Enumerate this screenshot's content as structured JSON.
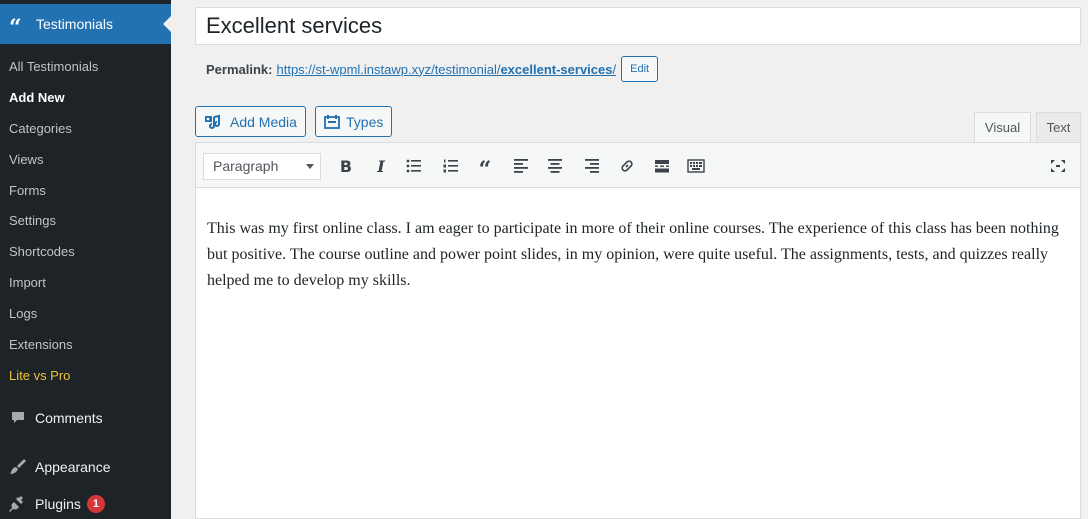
{
  "sidebar": {
    "active_menu": {
      "label": "Testimonials",
      "icon": "quote-icon"
    },
    "submenu": [
      {
        "label": "All Testimonials",
        "state": "normal"
      },
      {
        "label": "Add New",
        "state": "current"
      },
      {
        "label": "Categories",
        "state": "normal"
      },
      {
        "label": "Views",
        "state": "normal"
      },
      {
        "label": "Forms",
        "state": "normal"
      },
      {
        "label": "Settings",
        "state": "normal"
      },
      {
        "label": "Shortcodes",
        "state": "normal"
      },
      {
        "label": "Import",
        "state": "normal"
      },
      {
        "label": "Logs",
        "state": "normal"
      },
      {
        "label": "Extensions",
        "state": "normal"
      },
      {
        "label": "Lite vs Pro",
        "state": "highlight"
      }
    ],
    "menu": [
      {
        "label": "Comments",
        "icon": "comment-icon"
      },
      {
        "label": "Appearance",
        "icon": "brush-icon"
      },
      {
        "label": "Plugins",
        "icon": "plugin-icon",
        "badge": "1"
      }
    ]
  },
  "post": {
    "title": "Excellent services",
    "permalink_label": "Permalink:",
    "permalink_base": "https://st-wpml.instawp.xyz/testimonial/",
    "permalink_slug": "excellent-services",
    "permalink_trailing": "/",
    "edit_label": "Edit"
  },
  "media_buttons": {
    "add_media": "Add Media",
    "types": "Types"
  },
  "editor_tabs": {
    "visual": "Visual",
    "text": "Text",
    "active": "visual"
  },
  "toolbar": {
    "format_value": "Paragraph",
    "bold_glyph": "B",
    "italic_glyph": "I",
    "buttons": [
      "bold-icon",
      "italic-icon",
      "bullet-list-icon",
      "numbered-list-icon",
      "blockquote-icon",
      "align-left-icon",
      "align-center-icon",
      "align-right-icon",
      "link-icon",
      "read-more-icon",
      "toolbar-toggle-icon",
      "fullscreen-icon"
    ]
  },
  "content": {
    "text": "This was my first online class. I am eager to participate in more of their online courses. The experience of this class has been nothing but positive. The course outline and power point slides, in my opinion, were quite useful. The assignments, tests, and quizzes really helped me to develop my skills."
  },
  "colors": {
    "sidebar_bg": "#1d2327",
    "accent": "#2271b1",
    "highlight": "#f0c33c",
    "badge": "#d63638"
  }
}
